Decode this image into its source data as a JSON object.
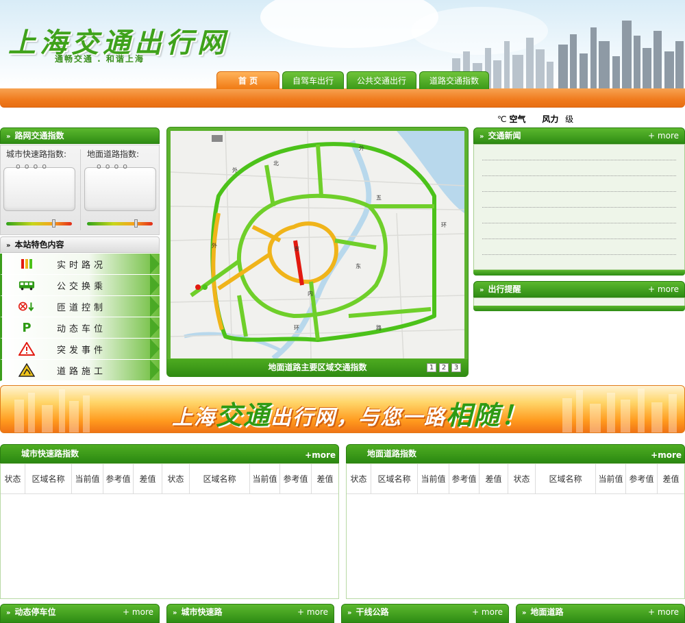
{
  "site": {
    "title": "上海交通出行网",
    "subtitle": "通畅交通 . 和谐上海"
  },
  "nav": [
    "首 页",
    "自驾车出行",
    "公共交通出行",
    "道路交通指数"
  ],
  "weather": {
    "unit": "℃",
    "air": "空气",
    "wind_label": "风力",
    "wind_unit": "级"
  },
  "traffic_index": {
    "title": "路网交通指数",
    "expressway_label": "城市快速路指数:",
    "surface_label": "地面道路指数:"
  },
  "features": {
    "title": "本站特色内容",
    "items": [
      {
        "label": "实时路况",
        "icon": "traffic-light-icon"
      },
      {
        "label": "公交换乘",
        "icon": "bus-icon"
      },
      {
        "label": "匝道控制",
        "icon": "ramp-control-icon"
      },
      {
        "label": "动态车位",
        "icon": "parking-icon"
      },
      {
        "label": "突发事件",
        "icon": "warning-icon"
      },
      {
        "label": "道路施工",
        "icon": "construction-icon"
      }
    ]
  },
  "map": {
    "caption": "地面道路主要区域交通指数",
    "pages": [
      "1",
      "2",
      "3"
    ],
    "colors": {
      "smooth": "#4cc21a",
      "slow": "#f0b41a",
      "jam": "#e21a10",
      "water": "#b8d8ec"
    }
  },
  "news": {
    "title": "交通新闻",
    "more": "+ more"
  },
  "tips": {
    "title": "出行提醒",
    "more": "+ more"
  },
  "banner": {
    "part1": "上海",
    "part2": "交通",
    "part3": "出行网，与您一路",
    "part4": "相随！"
  },
  "tables": {
    "expressway": {
      "title": "城市快速路指数",
      "more": "+more"
    },
    "surface": {
      "title": "地面道路指数",
      "more": "+more"
    },
    "columns": [
      "状态",
      "区域名称",
      "当前值",
      "参考值",
      "差值",
      "状态",
      "区域名称",
      "当前值",
      "参考值",
      "差值"
    ]
  },
  "bottom": [
    {
      "title": "动态停车位",
      "more": "+ more"
    },
    {
      "title": "城市快速路",
      "more": "+ more"
    },
    {
      "title": "干线公路",
      "more": "+ more"
    },
    {
      "title": "地面道路",
      "more": "+ more"
    }
  ]
}
